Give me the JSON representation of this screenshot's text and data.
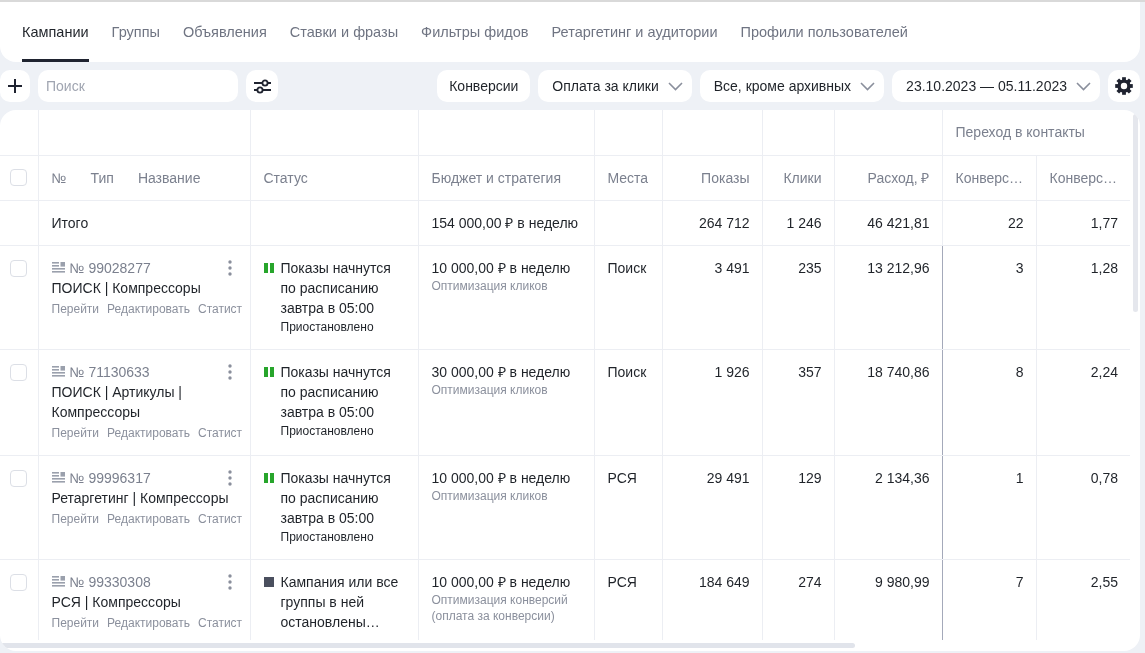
{
  "tabs": [
    {
      "label": "Кампании",
      "selected": true
    },
    {
      "label": "Группы",
      "selected": false
    },
    {
      "label": "Объявления",
      "selected": false
    },
    {
      "label": "Ставки и фразы",
      "selected": false
    },
    {
      "label": "Фильтры фидов",
      "selected": false
    },
    {
      "label": "Ретаргетинг и аудитории",
      "selected": false
    },
    {
      "label": "Профили пользователей",
      "selected": false
    }
  ],
  "toolbar": {
    "search": {
      "placeholder": "Поиск"
    },
    "filters": [
      {
        "kind": "button",
        "label": "Конверсии"
      },
      {
        "kind": "dropdown",
        "label": "Оплата за клики"
      },
      {
        "kind": "dropdown",
        "label": "Все, кроме архивных"
      },
      {
        "kind": "dropdown",
        "label": "23.10.2023 — 05.11.2023"
      }
    ]
  },
  "table": {
    "select_all": {
      "checked": false
    },
    "name_column": [
      "№",
      "Тип",
      "Название"
    ],
    "column_group": "Переход в контакты",
    "columns": [
      {
        "kind": "status",
        "label": "Статус"
      },
      {
        "kind": "budget",
        "label": "Бюджет и стратегия"
      },
      {
        "kind": "places",
        "label": "Места"
      },
      {
        "kind": "number",
        "label": "Показы"
      },
      {
        "kind": "number",
        "label": "Клики"
      },
      {
        "kind": "number",
        "label": "Расход, ₽"
      },
      {
        "kind": "contact_metric",
        "label": "Конверс…"
      },
      {
        "kind": "contact_metric",
        "label": "Конверс…"
      }
    ],
    "total": {
      "label": "Итого",
      "budget": "154 000,00 ₽ в неделю",
      "metrics": [
        "264 712",
        "1 246",
        "46 421,81",
        "22",
        "1,77"
      ]
    },
    "rows": [
      {
        "selected": false,
        "number": "№ 99028277",
        "name": "ПОИСК | Компрессоры",
        "actions": [
          "Перейти",
          "Редактировать",
          "Статист"
        ],
        "status": {
          "kind": "paused",
          "text": "Показы начнутся по расписанию завтра в 05:00",
          "label": "Приостановлено"
        },
        "budget": "10 000,00 ₽ в неделю",
        "strategy": "Оптимизация кликов",
        "places": "Поиск",
        "metrics": [
          "3 491",
          "235",
          "13 212,96",
          "3",
          "1,28"
        ]
      },
      {
        "selected": false,
        "number": "№ 71130633",
        "name": "ПОИСК | Артикулы | Компрессоры",
        "actions": [
          "Перейти",
          "Редактировать",
          "Статист"
        ],
        "status": {
          "kind": "paused",
          "text": "Показы начнутся по расписанию завтра в 05:00",
          "label": "Приостановлено"
        },
        "budget": "30 000,00 ₽ в неделю",
        "strategy": "Оптимизация кликов",
        "places": "Поиск",
        "metrics": [
          "1 926",
          "357",
          "18 740,86",
          "8",
          "2,24"
        ]
      },
      {
        "selected": false,
        "number": "№ 99996317",
        "name": "Ретаргетинг | Компрессоры",
        "actions": [
          "Перейти",
          "Редактировать",
          "Статист"
        ],
        "status": {
          "kind": "paused",
          "text": "Показы начнутся по расписанию завтра в 05:00",
          "label": "Приостановлено"
        },
        "budget": "10 000,00 ₽ в неделю",
        "strategy": "Оптимизация кликов",
        "places": "РСЯ",
        "metrics": [
          "29 491",
          "129",
          "2 134,36",
          "1",
          "0,78"
        ]
      },
      {
        "selected": false,
        "number": "№ 99330308",
        "name": "РСЯ | Компрессоры",
        "actions": [
          "Перейти",
          "Редактировать",
          "Статист"
        ],
        "status": {
          "kind": "stopped",
          "text": "Кампания или все группы в ней остановлены…"
        },
        "budget": "10 000,00 ₽ в неделю",
        "strategy": "Оптимизация конверсий (оплата за конверсии)",
        "places": "РСЯ",
        "metrics": [
          "184 649",
          "274",
          "9 980,99",
          "7",
          "2,55"
        ]
      }
    ]
  }
}
